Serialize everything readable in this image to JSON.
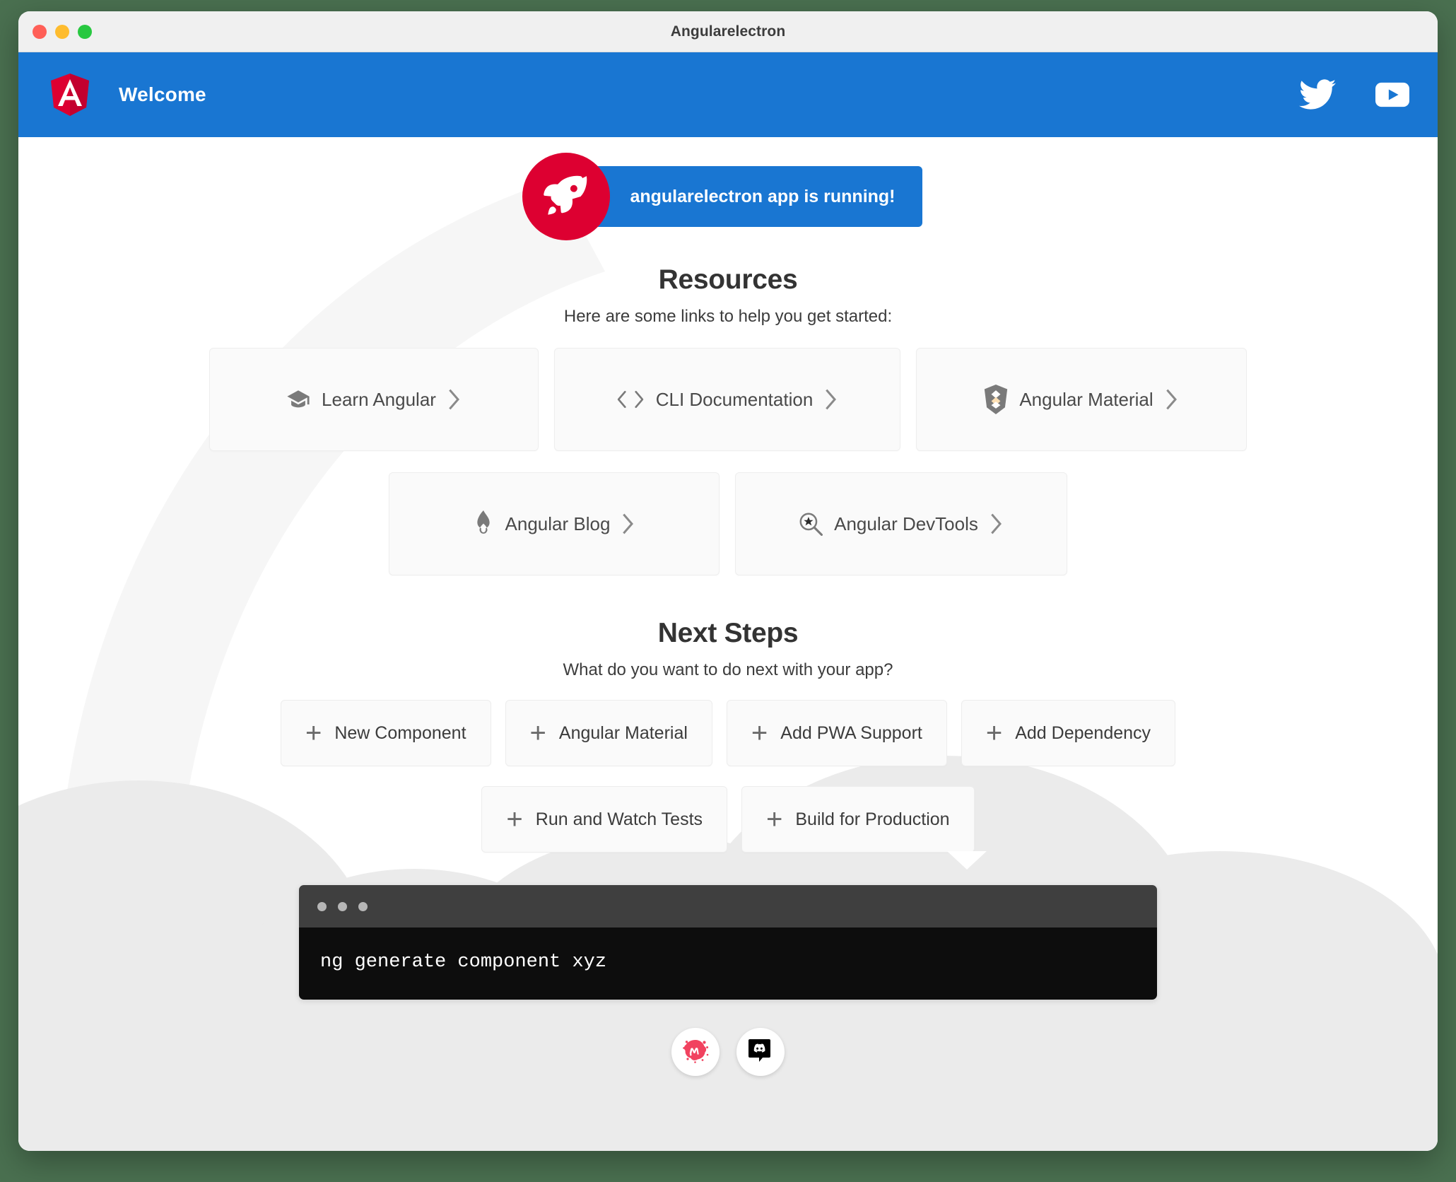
{
  "window": {
    "title": "Angularelectron",
    "traffic_lights": [
      {
        "name": "close",
        "color": "#ff5f57"
      },
      {
        "name": "minimize",
        "color": "#febc2e"
      },
      {
        "name": "maximize",
        "color": "#28c840"
      }
    ]
  },
  "toolbar": {
    "title": "Welcome",
    "brand_icon": "angular-logo",
    "accent_color": "#1976d2",
    "social": [
      {
        "name": "twitter-icon",
        "label": "Twitter"
      },
      {
        "name": "youtube-icon",
        "label": "YouTube"
      }
    ]
  },
  "hero": {
    "rocket_icon": "rocket-icon",
    "rocket_bg": "#dd0031",
    "pill_text": "angularelectron app is running!",
    "pill_bg": "#1976d2"
  },
  "resources": {
    "title": "Resources",
    "subtitle": "Here are some links to help you get started:",
    "row1": [
      {
        "label": "Learn Angular",
        "icon": "graduation-cap-icon",
        "chevron": "›"
      },
      {
        "label": "CLI Documentation",
        "icon": "code-brackets-icon",
        "chevron": "›"
      },
      {
        "label": "Angular Material",
        "icon": "angular-material-shield-icon",
        "chevron": "›"
      }
    ],
    "row2": [
      {
        "label": "Angular Blog",
        "icon": "flame-icon",
        "chevron": "›"
      },
      {
        "label": "Angular DevTools",
        "icon": "magnifier-star-icon",
        "chevron": "›"
      }
    ]
  },
  "next_steps": {
    "title": "Next Steps",
    "subtitle": "What do you want to do next with your app?",
    "row1": [
      {
        "label": "New Component",
        "icon": "plus-icon"
      },
      {
        "label": "Angular Material",
        "icon": "plus-icon"
      },
      {
        "label": "Add PWA Support",
        "icon": "plus-icon"
      },
      {
        "label": "Add Dependency",
        "icon": "plus-icon"
      }
    ],
    "row2": [
      {
        "label": "Run and Watch Tests",
        "icon": "plus-icon"
      },
      {
        "label": "Build for Production",
        "icon": "plus-icon"
      }
    ]
  },
  "terminal": {
    "command": "ng generate component xyz",
    "bar_color": "#3f3f3f",
    "body_color": "#0d0d0d",
    "dots": 3
  },
  "footer": {
    "social": [
      {
        "name": "meetup-icon",
        "label": "Meetup",
        "color": "#f1425f"
      },
      {
        "name": "discord-icon",
        "label": "Discord",
        "color": "#000000"
      }
    ]
  }
}
